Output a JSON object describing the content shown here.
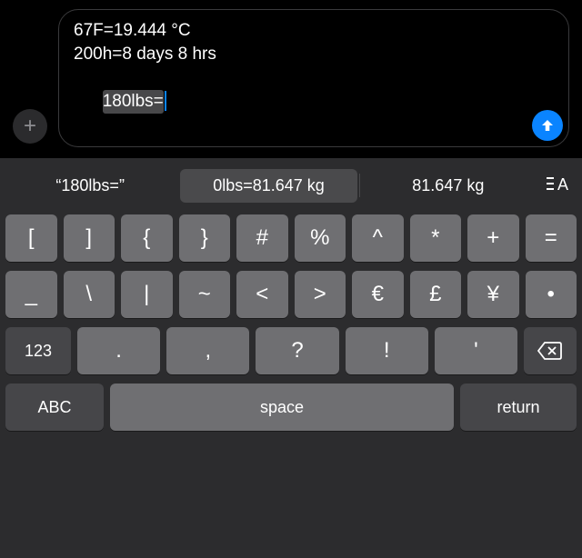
{
  "compose": {
    "plus_label": "+",
    "line1": "67F=19.444 °C",
    "line2": "200h=8 days 8 hrs",
    "current": "180lbs="
  },
  "suggestions": {
    "s1": "“180lbs=”",
    "s2": "0lbs=81.647 kg",
    "s3": "81.647 kg"
  },
  "keys": {
    "r1": {
      "k0": "[",
      "k1": "]",
      "k2": "{",
      "k3": "}",
      "k4": "#",
      "k5": "%",
      "k6": "^",
      "k7": "*",
      "k8": "+",
      "k9": "="
    },
    "r2": {
      "k0": "_",
      "k1": "\\",
      "k2": "|",
      "k3": "~",
      "k4": "<",
      "k5": ">",
      "k6": "€",
      "k7": "£",
      "k8": "¥",
      "k9": "•"
    },
    "r3": {
      "numswitch": "123",
      "k0": ".",
      "k1": ",",
      "k2": "?",
      "k3": "!",
      "k4": "'"
    },
    "r4": {
      "abc": "ABC",
      "space": "space",
      "return": "return"
    }
  }
}
